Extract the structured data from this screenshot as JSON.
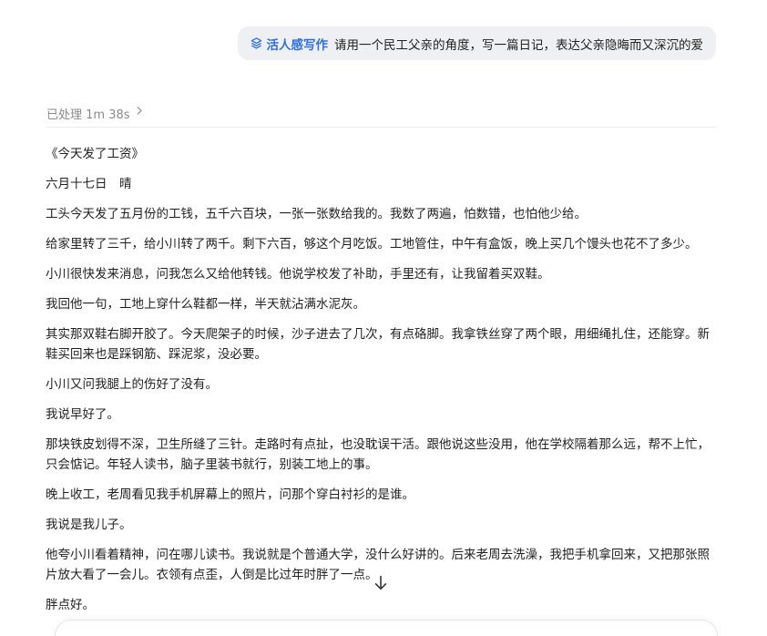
{
  "user_message": {
    "skill_tag": "活人感写作",
    "text": "请用一个民工父亲的角度，写一篇日记，表达父亲隐晦而又深沉的爱"
  },
  "process": {
    "label": "已处理 1m 38s"
  },
  "diary": {
    "title": "《今天发了工资》",
    "date_line": "六月十七日　晴",
    "paragraphs": [
      "工头今天发了五月份的工钱，五千六百块，一张一张数给我的。我数了两遍，怕数错，也怕他少给。",
      "给家里转了三千，给小川转了两千。剩下六百，够这个月吃饭。工地管住，中午有盒饭，晚上买几个馒头也花不了多少。",
      "小川很快发来消息，问我怎么又给他转钱。他说学校发了补助，手里还有，让我留着买双鞋。",
      "我回他一句，工地上穿什么鞋都一样，半天就沾满水泥灰。",
      "其实那双鞋右脚开胶了。今天爬架子的时候，沙子进去了几次，有点硌脚。我拿铁丝穿了两个眼，用细绳扎住，还能穿。新鞋买回来也是踩钢筋、踩泥浆，没必要。",
      "小川又问我腿上的伤好了没有。",
      "我说早好了。",
      "那块铁皮划得不深，卫生所缝了三针。走路时有点扯，也没耽误干活。跟他说这些没用，他在学校隔着那么远，帮不上忙，只会惦记。年轻人读书，脑子里装书就行，别装工地上的事。",
      "晚上收工，老周看见我手机屏幕上的照片，问那个穿白衬衫的是谁。",
      "我说是我儿子。",
      "他夸小川看着精神，问在哪儿读书。我说就是个普通大学，没什么好讲的。后来老周去洗澡，我把手机拿回来，又把那张照片放大看了一会儿。衣领有点歪，人倒是比过年时胖了一点。",
      "胖点好。"
    ]
  },
  "icons": {
    "skill": "layers-icon",
    "process_chevron": "chevron-right-icon",
    "scroll": "arrow-down-icon"
  },
  "colors": {
    "accent": "#2f6fe0",
    "bubble_bg": "#eef0f4",
    "muted_text": "#8a8a8a"
  }
}
